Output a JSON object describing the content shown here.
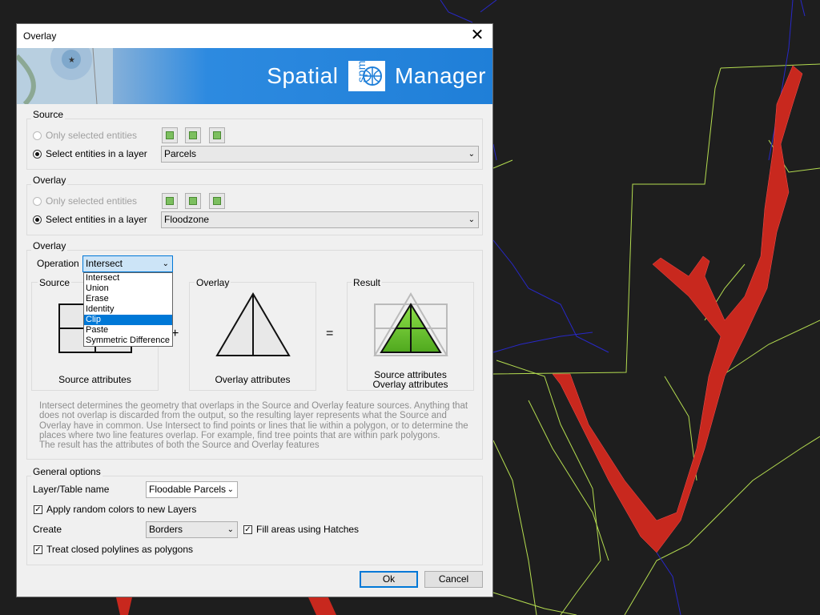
{
  "window": {
    "title": "Overlay"
  },
  "banner": {
    "brand_left": "Spatial",
    "logo_text": "spm",
    "brand_right": "Manager"
  },
  "source_group": {
    "title": "Source",
    "opt_selected": "Only selected entities",
    "opt_layer": "Select entities in a layer",
    "layer_value": "Parcels"
  },
  "overlay_group": {
    "title": "Overlay",
    "opt_selected": "Only selected entities",
    "opt_layer": "Select entities in a layer",
    "layer_value": "Floodzone"
  },
  "operation_group": {
    "title": "Overlay",
    "operation_label": "Operation",
    "operation_value": "Intersect",
    "options": [
      "Intersect",
      "Union",
      "Erase",
      "Identity",
      "Clip",
      "Paste",
      "Symmetric Difference"
    ],
    "highlighted_option": "Clip",
    "source_panel": {
      "title": "Source",
      "caption": "Source attributes"
    },
    "overlay_panel": {
      "title": "Overlay",
      "caption": "Overlay attributes"
    },
    "result_panel": {
      "title": "Result",
      "caption_1": "Source attributes",
      "caption_2": "Overlay attributes"
    },
    "plus": "+",
    "equals": "=",
    "description": "Intersect determines the geometry that overlaps in the Source and Overlay feature sources. Anything that does not overlap is discarded from the output, so the resulting layer represents what the Source and Overlay have in common. Use Intersect to find points or lines that lie within a polygon, or to determine the places where two line features overlap. For example, find tree points that are within park polygons.",
    "description_2": "The result has the attributes of both the Source and Overlay features"
  },
  "general_options": {
    "title": "General options",
    "layer_name_label": "Layer/Table name",
    "layer_name_value": "Floodable Parcels",
    "random_colors_label": "Apply random colors to new Layers",
    "create_label": "Create",
    "create_value": "Borders",
    "fill_hatches_label": "Fill areas using Hatches",
    "closed_polylines_label": "Treat closed polylines as polygons"
  },
  "buttons": {
    "ok": "Ok",
    "cancel": "Cancel"
  },
  "colors": {
    "accent": "#0078d7",
    "result_fill": "#6cc832",
    "flood_red": "#c8281e",
    "parcel_line": "#b4dc50"
  }
}
